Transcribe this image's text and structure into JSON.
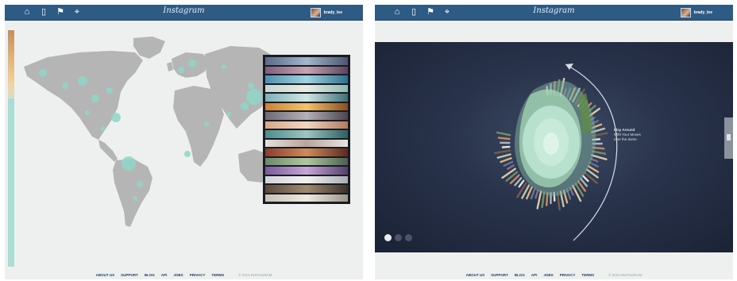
{
  "app": {
    "logo_text": "Instagram",
    "username": "brady_lee"
  },
  "nav": [
    {
      "name": "home-icon",
      "glyph": "⌂"
    },
    {
      "name": "tablet-icon",
      "glyph": "▯"
    },
    {
      "name": "map-icon",
      "glyph": "⚑"
    },
    {
      "name": "location-icon",
      "glyph": "⌖"
    }
  ],
  "footer": {
    "links": [
      "ABOUT US",
      "SUPPORT",
      "BLOG",
      "API",
      "JOBS",
      "PRIVACY",
      "TERMS"
    ],
    "copyright": "© 2013 INSTAGRAM"
  },
  "viz": {
    "caption_line1": "Play Around",
    "caption_line2": "With Your Moves",
    "caption_line3": "over the dome"
  },
  "pager": {
    "count": 3,
    "active": 0
  },
  "colors": {
    "topbar": "#2e5b84",
    "map_land": "#b5b5b5",
    "bubble": "#8fd8c8",
    "viewer_bg": "#1a2234"
  }
}
